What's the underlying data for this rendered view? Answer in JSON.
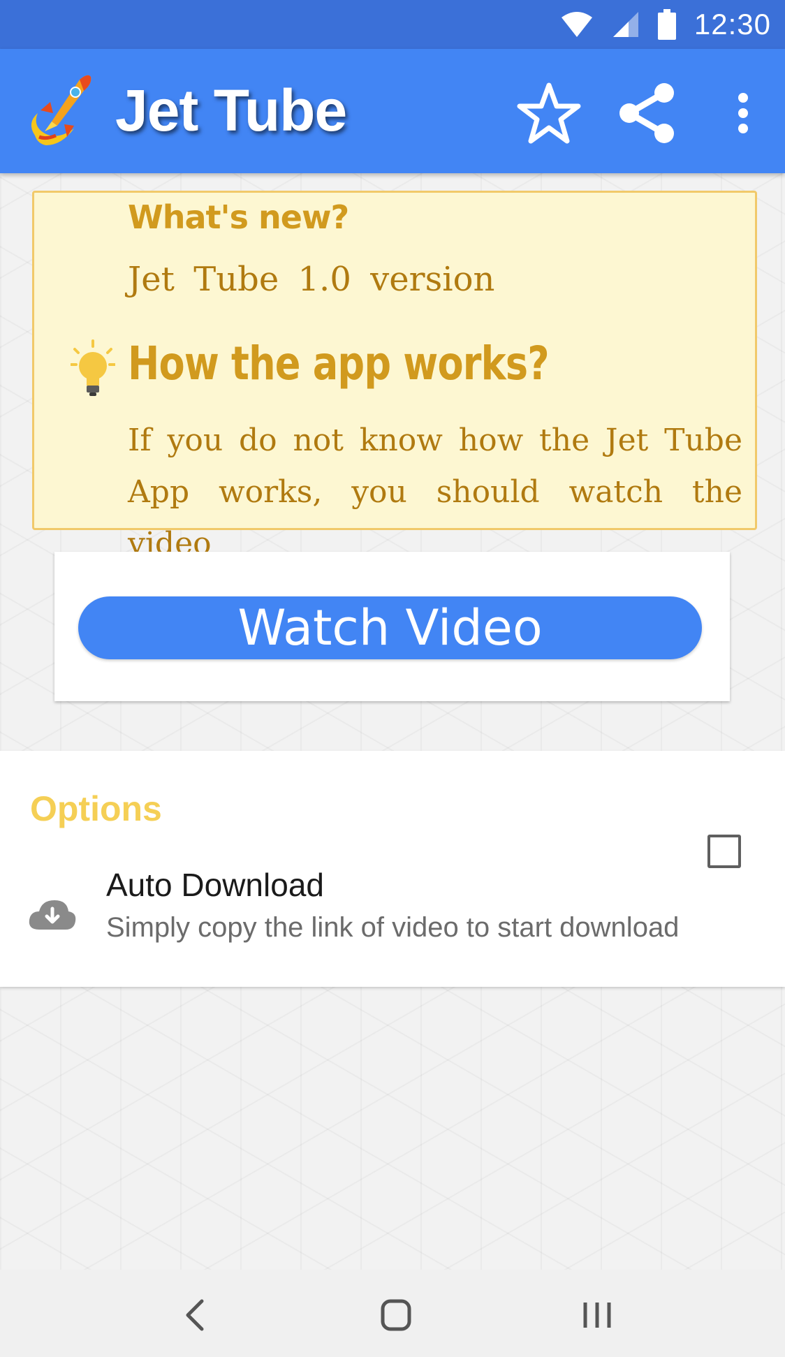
{
  "status_bar": {
    "time": "12:30",
    "icons": [
      "wifi-icon",
      "signal-icon",
      "battery-icon"
    ]
  },
  "app_bar": {
    "title": "Jet Tube",
    "logo": "rocket-logo",
    "actions": [
      "star-icon",
      "share-icon",
      "more-vert-icon"
    ]
  },
  "whats_new": {
    "heading": "What's new?",
    "version_text": "Jet Tube 1.0 version",
    "how_heading": "How the app works?",
    "how_body": "If you do not know how the Jet Tube App works, you should watch the video",
    "icon": "lightbulb-icon"
  },
  "watch_video": {
    "button_label": "Watch Video"
  },
  "options": {
    "title": "Options",
    "auto_download": {
      "title": "Auto Download",
      "description": "Simply copy the link of video to start download",
      "checked": false,
      "icon": "cloud-download-icon"
    }
  },
  "nav_bar": {
    "buttons": [
      "back-icon",
      "home-icon",
      "recents-icon"
    ]
  },
  "colors": {
    "status_bar": "#3b70d8",
    "app_bar": "#4285f4",
    "card_bg": "#fdf7d2",
    "card_border": "#f1c96a",
    "heading_gold": "#d19a1e",
    "body_gold": "#b07a10",
    "options_title": "#f5cf55",
    "button_blue": "#4285f4"
  }
}
